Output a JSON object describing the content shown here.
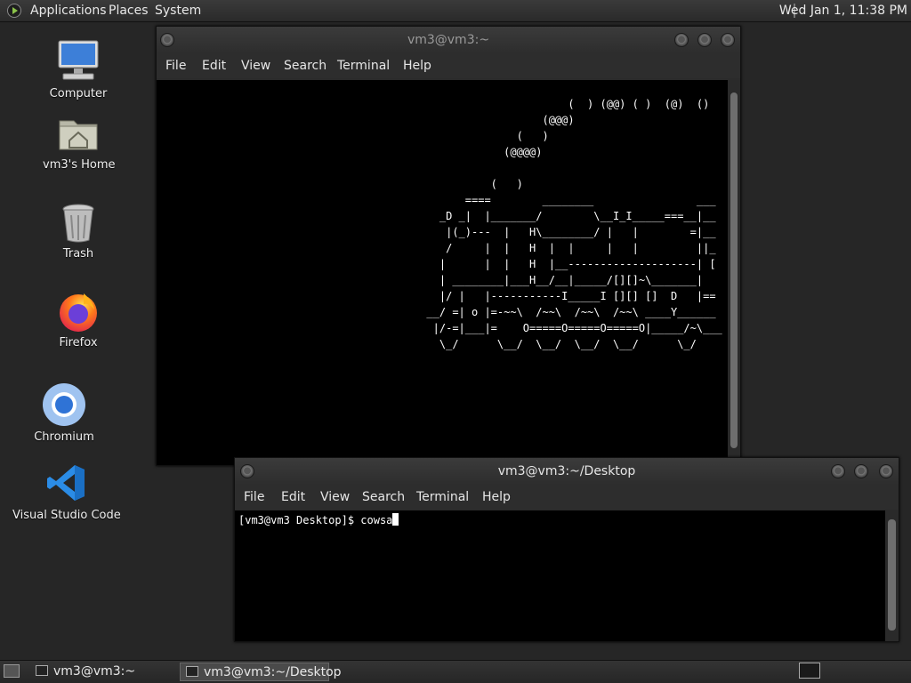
{
  "top_panel": {
    "applications": "Applications",
    "places": "Places",
    "system": "System",
    "clock": "Wed Jan  1, 11:38 PM"
  },
  "desktop_icons": {
    "computer": "Computer",
    "home": "vm3's Home",
    "trash": "Trash",
    "firefox": "Firefox",
    "chromium": "Chromium",
    "vscode": "Visual Studio Code"
  },
  "window1": {
    "title": "vm3@vm3:~",
    "menu": [
      "File",
      "Edit",
      "View",
      "Search",
      "Terminal",
      "Help"
    ],
    "content": "                                                                (  ) (@@) ( )  (@)  ()\n                                                            (@@@)\n                                                        (   )\n                                                      (@@@@)\n\n                                                    (   )\n                                                ====        ________                ___\n                                            _D _|  |_______/        \\__I_I_____===__|__\n                                             |(_)---  |   H\\________/ |   |        =|__\n                                             /     |  |   H  |  |     |   |         ||_\n                                            |      |  |   H  |__--------------------| [\n                                            | ________|___H__/__|_____/[][]~\\_______|\n                                            |/ |   |-----------I_____I [][] []  D   |==\n                                          __/ =| o |=-~~\\  /~~\\  /~~\\  /~~\\ ____Y______\n                                           |/-=|___|=    O=====O=====O=====O|_____/~\\___\n                                            \\_/      \\__/  \\__/  \\__/  \\__/      \\_/"
  },
  "window2": {
    "title": "vm3@vm3:~/Desktop",
    "menu": [
      "File",
      "Edit",
      "View",
      "Search",
      "Terminal",
      "Help"
    ],
    "prompt": "[vm3@vm3 Desktop]$ cowsa"
  },
  "taskbar": {
    "task1": "vm3@vm3:~",
    "task2": "vm3@vm3:~/Desktop"
  }
}
